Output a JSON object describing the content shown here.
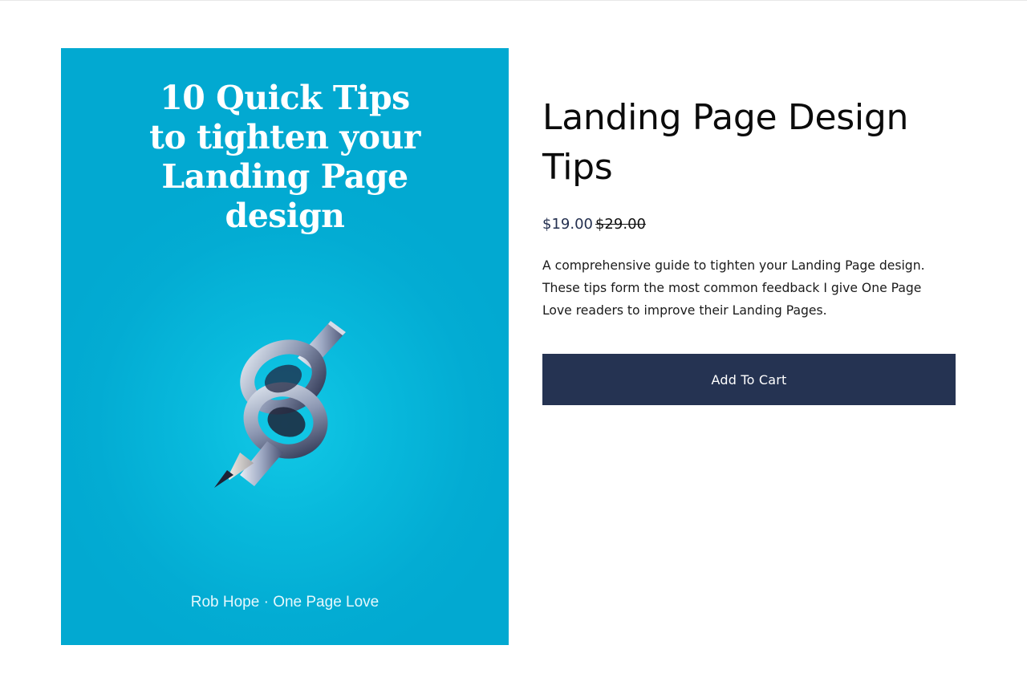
{
  "cover": {
    "title": "10 Quick Tips\nto tighten your\nLanding Page\ndesign",
    "author": "Rob Hope · One Page Love",
    "illustration": "knotted-pencil-icon",
    "background_color": "#02a9d1"
  },
  "product": {
    "title": "Landing Page Design Tips",
    "sale_price": "$19.00",
    "regular_price": "$29.00",
    "description": "A comprehensive guide to tighten your Landing Page design. These tips form the most common feedback I give One Page Love readers to improve their Landing Pages."
  },
  "cart": {
    "button_label": "Add To Cart",
    "button_color": "#253352"
  }
}
